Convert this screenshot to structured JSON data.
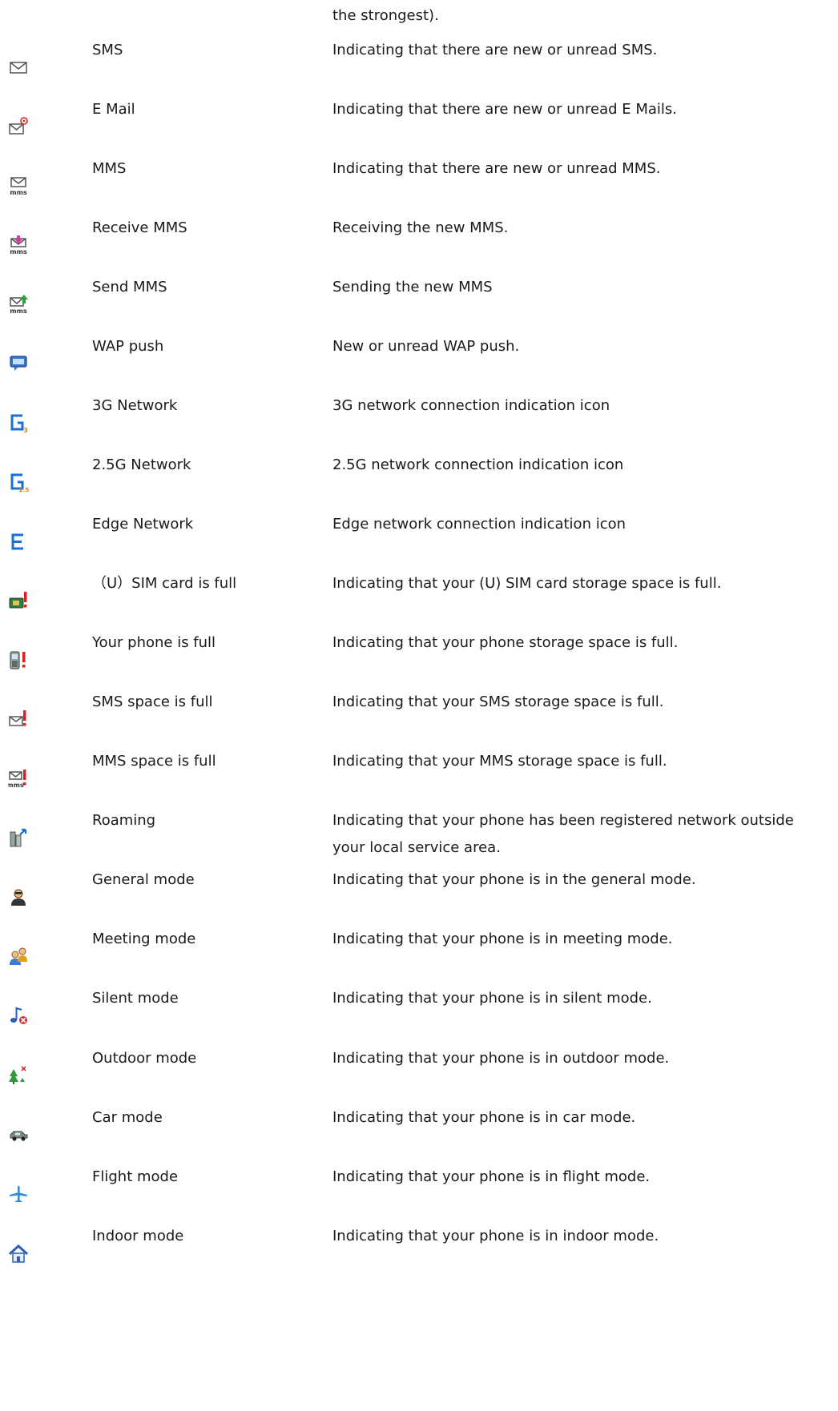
{
  "continuation": "the strongest).",
  "rows": [
    {
      "icon": "envelope-icon",
      "name": "SMS",
      "desc": "Indicating that there are new or unread SMS."
    },
    {
      "icon": "email-at-icon",
      "name": "E Mail",
      "desc": "Indicating that there are new or unread E Mails."
    },
    {
      "icon": "mms-envelope-icon",
      "name": "MMS",
      "desc": "Indicating that there are new or unread MMS."
    },
    {
      "icon": "mms-receive-icon",
      "name": "Receive MMS",
      "desc": "Receiving the new MMS."
    },
    {
      "icon": "mms-send-icon",
      "name": "Send MMS",
      "desc": "Sending the new MMS"
    },
    {
      "icon": "wap-push-icon",
      "name": "WAP push",
      "desc": "New or unread WAP push."
    },
    {
      "icon": "network-3g-icon",
      "name": "3G Network",
      "desc": "3G network connection indication icon"
    },
    {
      "icon": "network-25g-icon",
      "name": "2.5G Network",
      "desc": "2.5G network connection indication icon"
    },
    {
      "icon": "edge-network-icon",
      "name": "Edge Network",
      "desc": "Edge network connection indication icon"
    },
    {
      "icon": "sim-full-icon",
      "name": "（U）SIM card is full",
      "desc": "Indicating that your (U) SIM card storage space is full."
    },
    {
      "icon": "phone-full-icon",
      "name": "Your phone is full",
      "desc": "Indicating that your phone storage space is full."
    },
    {
      "icon": "sms-full-icon",
      "name": "SMS space is full",
      "desc": "Indicating that your SMS storage space is full."
    },
    {
      "icon": "mms-full-icon",
      "name": "MMS space is full",
      "desc": "Indicating that your MMS storage space is full."
    },
    {
      "icon": "roaming-icon",
      "name": "Roaming",
      "desc": "Indicating that your phone has been registered network outside your local service area."
    },
    {
      "icon": "general-mode-icon",
      "name": "General mode",
      "desc": "Indicating that your phone is in the general mode."
    },
    {
      "icon": "meeting-mode-icon",
      "name": "Meeting mode",
      "desc": "Indicating that your phone is in meeting mode."
    },
    {
      "icon": "silent-mode-icon",
      "name": "Silent mode",
      "desc": "Indicating that your phone is in silent mode."
    },
    {
      "icon": "outdoor-mode-icon",
      "name": "Outdoor mode",
      "desc": "Indicating that your phone is in outdoor mode."
    },
    {
      "icon": "car-mode-icon",
      "name": "Car mode",
      "desc": "Indicating that your phone is in car mode."
    },
    {
      "icon": "flight-mode-icon",
      "name": "Flight mode",
      "desc": "Indicating that your phone is in flight mode."
    },
    {
      "icon": "indoor-mode-icon",
      "name": "Indoor mode",
      "desc": "Indicating that your phone is in indoor mode."
    }
  ]
}
